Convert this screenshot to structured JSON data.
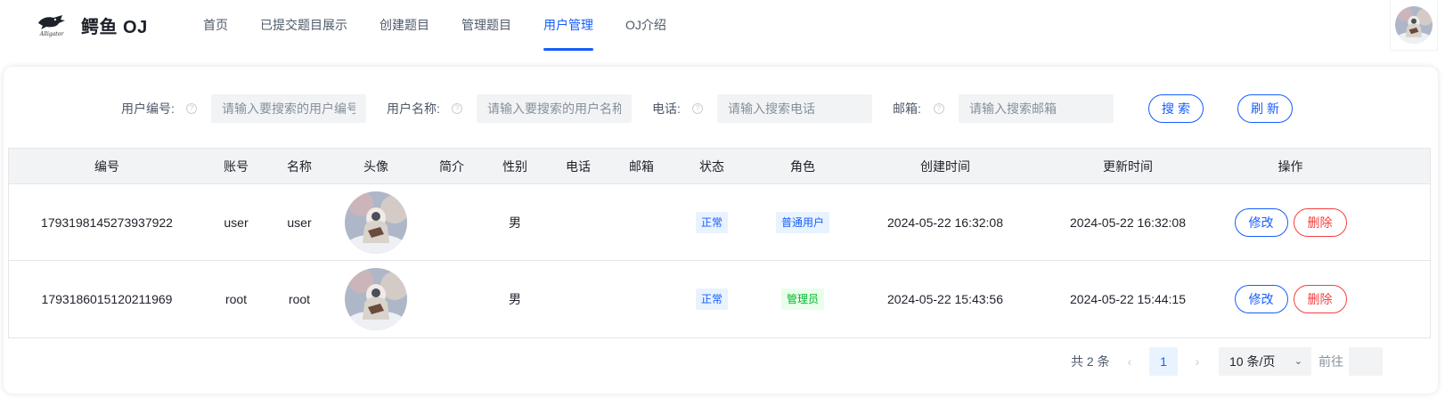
{
  "header": {
    "brand": "鳄鱼 OJ",
    "nav": [
      {
        "label": "首页",
        "active": false
      },
      {
        "label": "已提交题目展示",
        "active": false
      },
      {
        "label": "创建题目",
        "active": false
      },
      {
        "label": "管理题目",
        "active": false
      },
      {
        "label": "用户管理",
        "active": true
      },
      {
        "label": "OJ介绍",
        "active": false
      }
    ],
    "accent_color": "#165dff"
  },
  "search": {
    "user_id_label": "用户编号:",
    "user_id_placeholder": "请输入要搜索的用户编号",
    "user_name_label": "用户名称:",
    "user_name_placeholder": "请输入要搜索的用户名称",
    "phone_label": "电话:",
    "phone_placeholder": "请输入搜索电话",
    "email_label": "邮箱:",
    "email_placeholder": "请输入搜索邮箱",
    "search_button": "搜索",
    "refresh_button": "刷新"
  },
  "table": {
    "columns": [
      "编号",
      "账号",
      "名称",
      "头像",
      "简介",
      "性别",
      "电话",
      "邮箱",
      "状态",
      "角色",
      "创建时间",
      "更新时间",
      "操作"
    ],
    "rows": [
      {
        "id": "1793198145273937922",
        "account": "user",
        "name": "user",
        "avatar": "avatar-image",
        "profile": "",
        "gender": "男",
        "phone": "",
        "email": "",
        "status": "正常",
        "role": "普通用户",
        "created": "2024-05-22 16:32:08",
        "updated": "2024-05-22 16:32:08",
        "edit": "修改",
        "delete": "删除"
      },
      {
        "id": "1793186015120211969",
        "account": "root",
        "name": "root",
        "avatar": "avatar-image",
        "profile": "",
        "gender": "男",
        "phone": "",
        "email": "",
        "status": "正常",
        "role": "管理员",
        "created": "2024-05-22 15:43:56",
        "updated": "2024-05-22 15:44:15",
        "edit": "修改",
        "delete": "删除"
      }
    ]
  },
  "pagination": {
    "total": "共 2 条",
    "current_page": "1",
    "page_size": "10 条/页",
    "goto_label": "前往"
  }
}
